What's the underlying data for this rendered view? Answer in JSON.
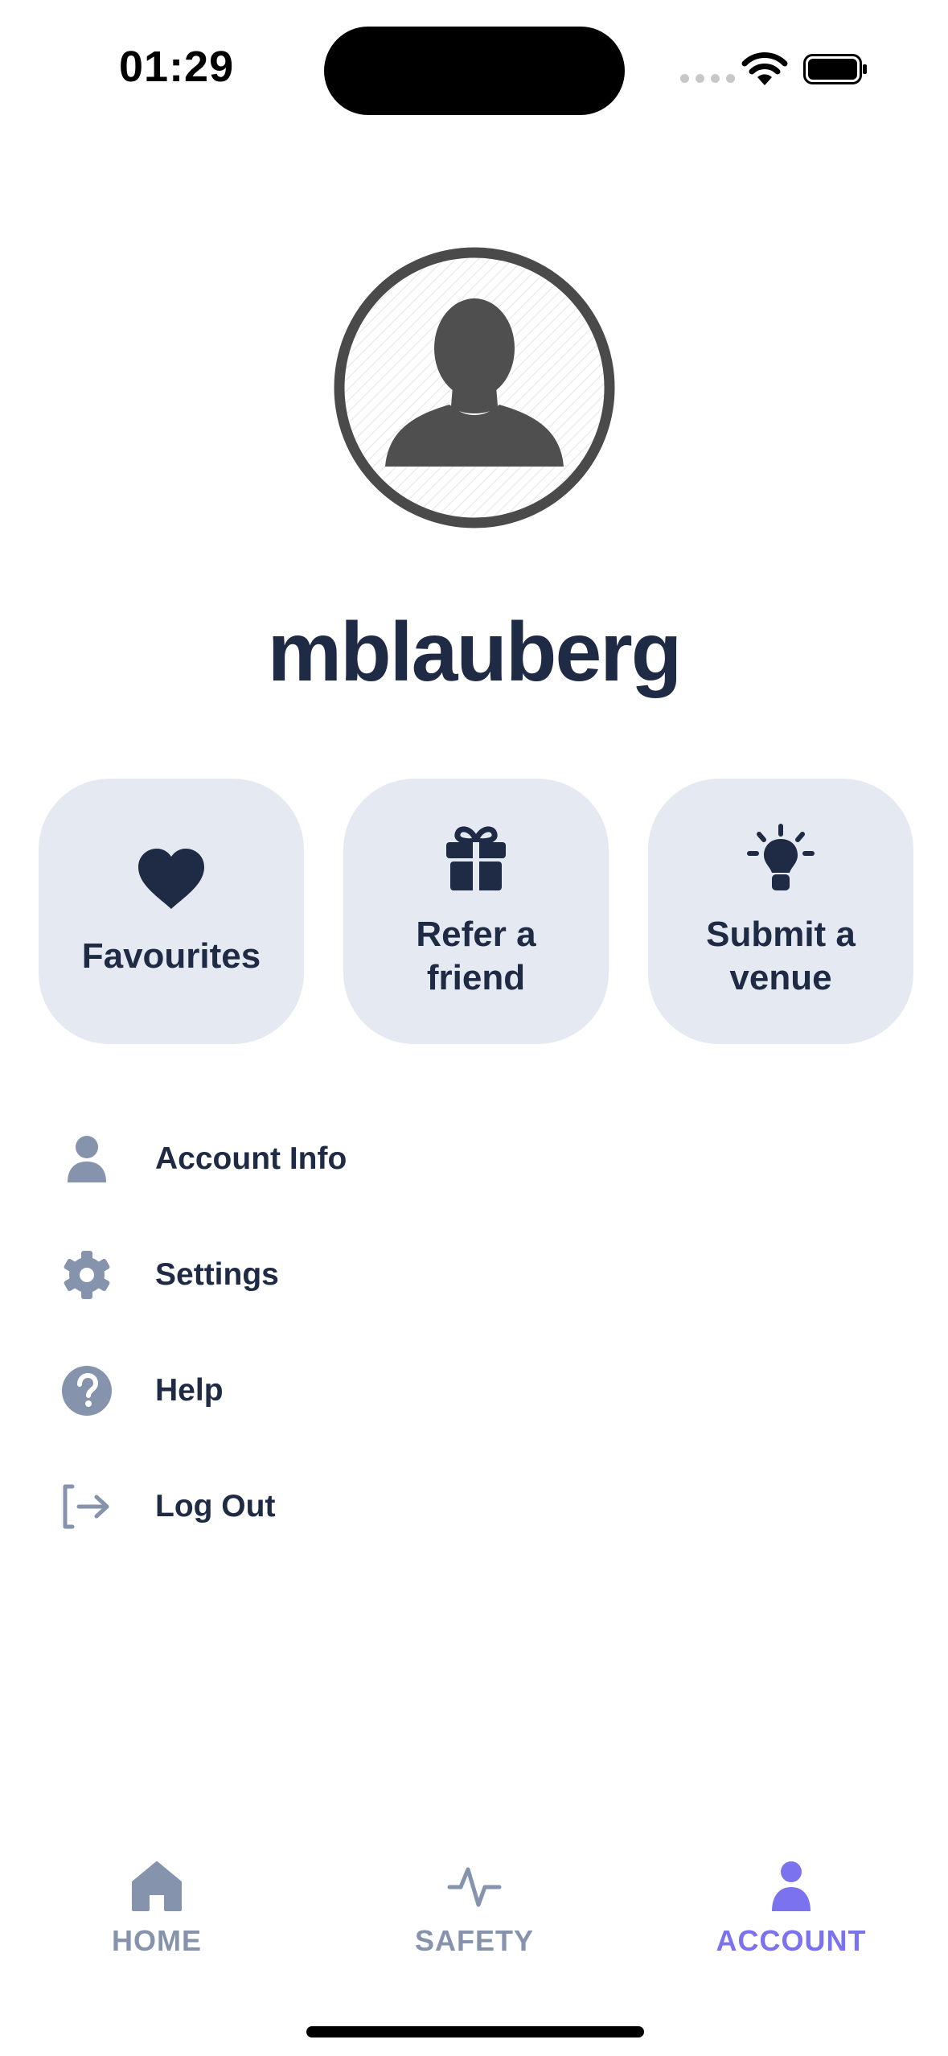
{
  "status_bar": {
    "time": "01:29"
  },
  "profile": {
    "username": "mblauberg"
  },
  "quick_actions": [
    {
      "label": "Favourites",
      "icon": "heart-icon"
    },
    {
      "label": "Refer a friend",
      "icon": "gift-icon"
    },
    {
      "label": "Submit a venue",
      "icon": "lightbulb-icon"
    }
  ],
  "menu": [
    {
      "label": "Account Info",
      "icon": "person-icon"
    },
    {
      "label": "Settings",
      "icon": "gear-icon"
    },
    {
      "label": "Help",
      "icon": "question-circle-icon"
    },
    {
      "label": "Log Out",
      "icon": "logout-icon"
    }
  ],
  "tabs": [
    {
      "label": "HOME",
      "icon": "home-icon",
      "active": false
    },
    {
      "label": "SAFETY",
      "icon": "pulse-icon",
      "active": false
    },
    {
      "label": "ACCOUNT",
      "icon": "person-icon",
      "active": true
    }
  ],
  "colors": {
    "primary_text": "#1f2a44",
    "card_background": "#e5e9f2",
    "menu_icon": "#8593ad",
    "tab_inactive": "#8593ad",
    "tab_active": "#7b72f0"
  }
}
